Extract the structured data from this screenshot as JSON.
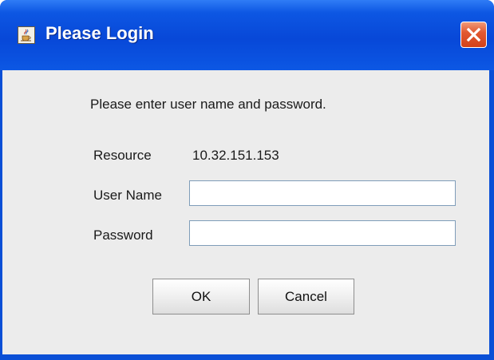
{
  "window": {
    "title": "Please Login",
    "icon": "java-cup-icon",
    "close_icon": "close-icon"
  },
  "dialog": {
    "instruction": "Please enter user name and password.",
    "resource_label": "Resource",
    "resource_value": "10.32.151.153",
    "username_label": "User Name",
    "username_value": "",
    "password_label": "Password",
    "password_value": ""
  },
  "buttons": {
    "ok_label": "OK",
    "cancel_label": "Cancel"
  },
  "colors": {
    "titlebar": "#0a4fd6",
    "title_text": "#ffffff",
    "close_button": "#d2411a",
    "background": "#ececec",
    "field_border": "#7f9db9"
  }
}
